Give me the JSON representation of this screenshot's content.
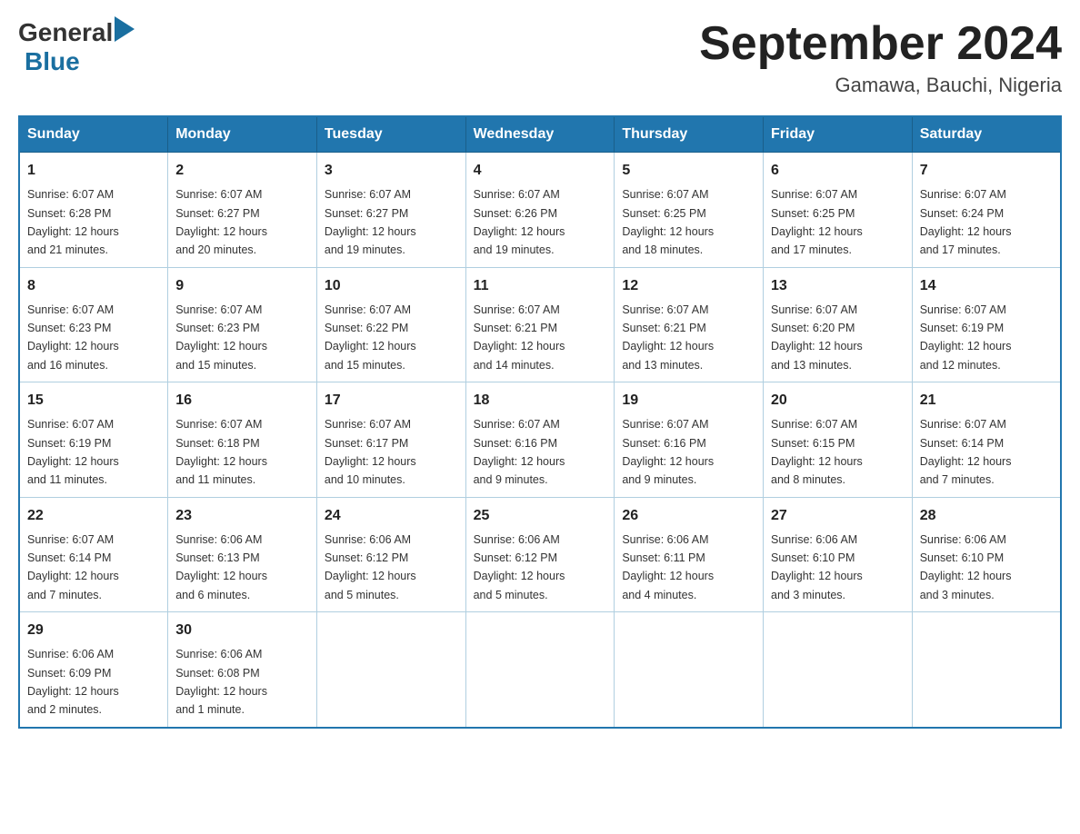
{
  "header": {
    "title": "September 2024",
    "subtitle": "Gamawa, Bauchi, Nigeria"
  },
  "logo": {
    "general": "General",
    "blue": "Blue"
  },
  "days": [
    "Sunday",
    "Monday",
    "Tuesday",
    "Wednesday",
    "Thursday",
    "Friday",
    "Saturday"
  ],
  "weeks": [
    [
      {
        "date": "1",
        "sunrise": "6:07 AM",
        "sunset": "6:28 PM",
        "daylight": "12 hours and 21 minutes."
      },
      {
        "date": "2",
        "sunrise": "6:07 AM",
        "sunset": "6:27 PM",
        "daylight": "12 hours and 20 minutes."
      },
      {
        "date": "3",
        "sunrise": "6:07 AM",
        "sunset": "6:27 PM",
        "daylight": "12 hours and 19 minutes."
      },
      {
        "date": "4",
        "sunrise": "6:07 AM",
        "sunset": "6:26 PM",
        "daylight": "12 hours and 19 minutes."
      },
      {
        "date": "5",
        "sunrise": "6:07 AM",
        "sunset": "6:25 PM",
        "daylight": "12 hours and 18 minutes."
      },
      {
        "date": "6",
        "sunrise": "6:07 AM",
        "sunset": "6:25 PM",
        "daylight": "12 hours and 17 minutes."
      },
      {
        "date": "7",
        "sunrise": "6:07 AM",
        "sunset": "6:24 PM",
        "daylight": "12 hours and 17 minutes."
      }
    ],
    [
      {
        "date": "8",
        "sunrise": "6:07 AM",
        "sunset": "6:23 PM",
        "daylight": "12 hours and 16 minutes."
      },
      {
        "date": "9",
        "sunrise": "6:07 AM",
        "sunset": "6:23 PM",
        "daylight": "12 hours and 15 minutes."
      },
      {
        "date": "10",
        "sunrise": "6:07 AM",
        "sunset": "6:22 PM",
        "daylight": "12 hours and 15 minutes."
      },
      {
        "date": "11",
        "sunrise": "6:07 AM",
        "sunset": "6:21 PM",
        "daylight": "12 hours and 14 minutes."
      },
      {
        "date": "12",
        "sunrise": "6:07 AM",
        "sunset": "6:21 PM",
        "daylight": "12 hours and 13 minutes."
      },
      {
        "date": "13",
        "sunrise": "6:07 AM",
        "sunset": "6:20 PM",
        "daylight": "12 hours and 13 minutes."
      },
      {
        "date": "14",
        "sunrise": "6:07 AM",
        "sunset": "6:19 PM",
        "daylight": "12 hours and 12 minutes."
      }
    ],
    [
      {
        "date": "15",
        "sunrise": "6:07 AM",
        "sunset": "6:19 PM",
        "daylight": "12 hours and 11 minutes."
      },
      {
        "date": "16",
        "sunrise": "6:07 AM",
        "sunset": "6:18 PM",
        "daylight": "12 hours and 11 minutes."
      },
      {
        "date": "17",
        "sunrise": "6:07 AM",
        "sunset": "6:17 PM",
        "daylight": "12 hours and 10 minutes."
      },
      {
        "date": "18",
        "sunrise": "6:07 AM",
        "sunset": "6:16 PM",
        "daylight": "12 hours and 9 minutes."
      },
      {
        "date": "19",
        "sunrise": "6:07 AM",
        "sunset": "6:16 PM",
        "daylight": "12 hours and 9 minutes."
      },
      {
        "date": "20",
        "sunrise": "6:07 AM",
        "sunset": "6:15 PM",
        "daylight": "12 hours and 8 minutes."
      },
      {
        "date": "21",
        "sunrise": "6:07 AM",
        "sunset": "6:14 PM",
        "daylight": "12 hours and 7 minutes."
      }
    ],
    [
      {
        "date": "22",
        "sunrise": "6:07 AM",
        "sunset": "6:14 PM",
        "daylight": "12 hours and 7 minutes."
      },
      {
        "date": "23",
        "sunrise": "6:06 AM",
        "sunset": "6:13 PM",
        "daylight": "12 hours and 6 minutes."
      },
      {
        "date": "24",
        "sunrise": "6:06 AM",
        "sunset": "6:12 PM",
        "daylight": "12 hours and 5 minutes."
      },
      {
        "date": "25",
        "sunrise": "6:06 AM",
        "sunset": "6:12 PM",
        "daylight": "12 hours and 5 minutes."
      },
      {
        "date": "26",
        "sunrise": "6:06 AM",
        "sunset": "6:11 PM",
        "daylight": "12 hours and 4 minutes."
      },
      {
        "date": "27",
        "sunrise": "6:06 AM",
        "sunset": "6:10 PM",
        "daylight": "12 hours and 3 minutes."
      },
      {
        "date": "28",
        "sunrise": "6:06 AM",
        "sunset": "6:10 PM",
        "daylight": "12 hours and 3 minutes."
      }
    ],
    [
      {
        "date": "29",
        "sunrise": "6:06 AM",
        "sunset": "6:09 PM",
        "daylight": "12 hours and 2 minutes."
      },
      {
        "date": "30",
        "sunrise": "6:06 AM",
        "sunset": "6:08 PM",
        "daylight": "12 hours and 1 minute."
      },
      null,
      null,
      null,
      null,
      null
    ]
  ]
}
